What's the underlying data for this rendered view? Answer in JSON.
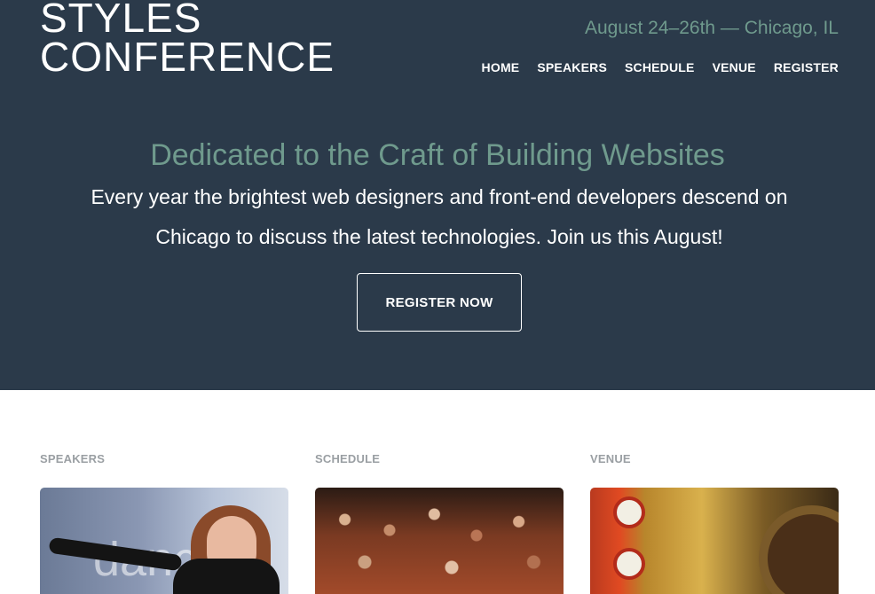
{
  "brand": {
    "line1": "STYLES",
    "line2": "CONFERENCE"
  },
  "tagline": "August 24–26th — Chicago, IL",
  "nav": {
    "items": [
      "HOME",
      "SPEAKERS",
      "SCHEDULE",
      "VENUE",
      "REGISTER"
    ]
  },
  "hero": {
    "title": "Dedicated to the Craft of Building Websites",
    "text": "Every year the brightest web designers and front-end developers descend on Chicago to discuss the latest technologies. Join us this August!",
    "cta": "REGISTER NOW"
  },
  "sections": [
    {
      "label": "SPEAKERS",
      "photo_text": "dance"
    },
    {
      "label": "SCHEDULE"
    },
    {
      "label": "VENUE"
    }
  ],
  "colors": {
    "header_bg": "#2b3a4a",
    "accent": "#6f9a8d",
    "section_label": "#9a9fa3"
  }
}
